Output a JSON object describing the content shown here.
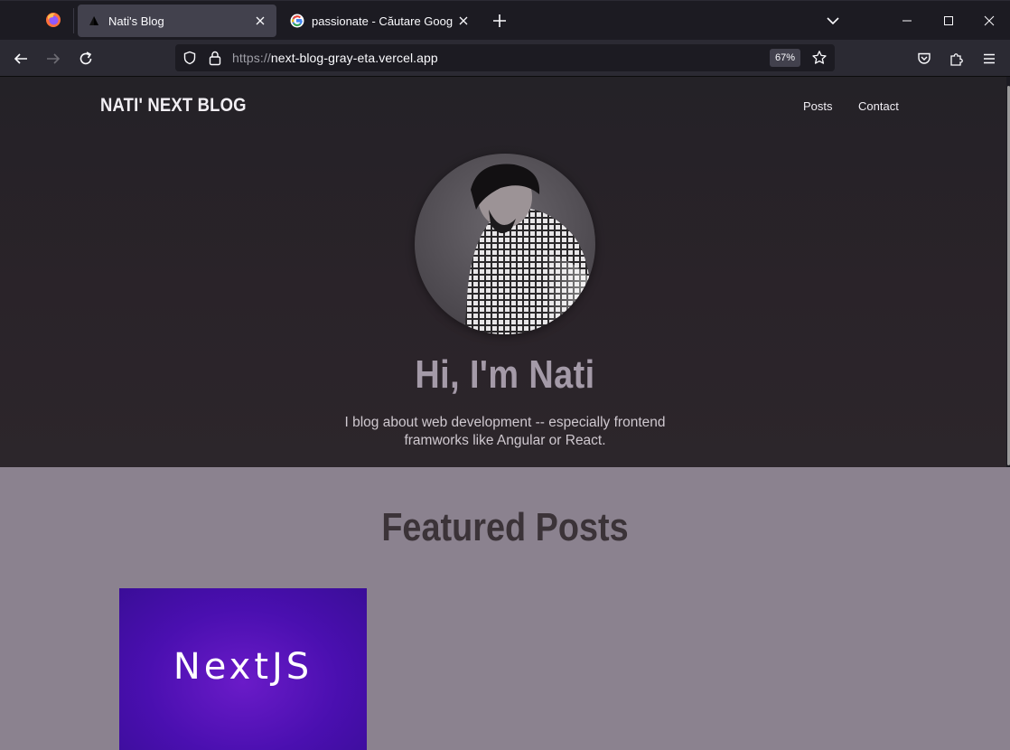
{
  "browser": {
    "tabs": [
      {
        "title": "Nati's Blog",
        "icon": "vercel-triangle-icon",
        "active": true
      },
      {
        "title": "passionate - Căutare Google",
        "icon": "google-g-icon",
        "active": false
      }
    ],
    "url_scheme": "https://",
    "url_host": "next-blog-gray-eta.vercel.app",
    "zoom_label": "67%"
  },
  "site": {
    "logo": "NATI' NEXT BLOG",
    "nav": [
      {
        "label": "Posts"
      },
      {
        "label": "Contact"
      }
    ]
  },
  "hero": {
    "title": "Hi, I'm Nati",
    "text": "I blog about web development -- especially frontend framworks like Angular or React."
  },
  "featured": {
    "title": "Featured Posts",
    "posts": [
      {
        "image_text": "NextJS"
      }
    ]
  },
  "colors": {
    "browser_bg": "#1c1b22",
    "toolbar_bg": "#2b2a33",
    "hero_bg": "#262328",
    "featured_bg": "#8b828f",
    "card_purple": "#4a0fb0"
  }
}
